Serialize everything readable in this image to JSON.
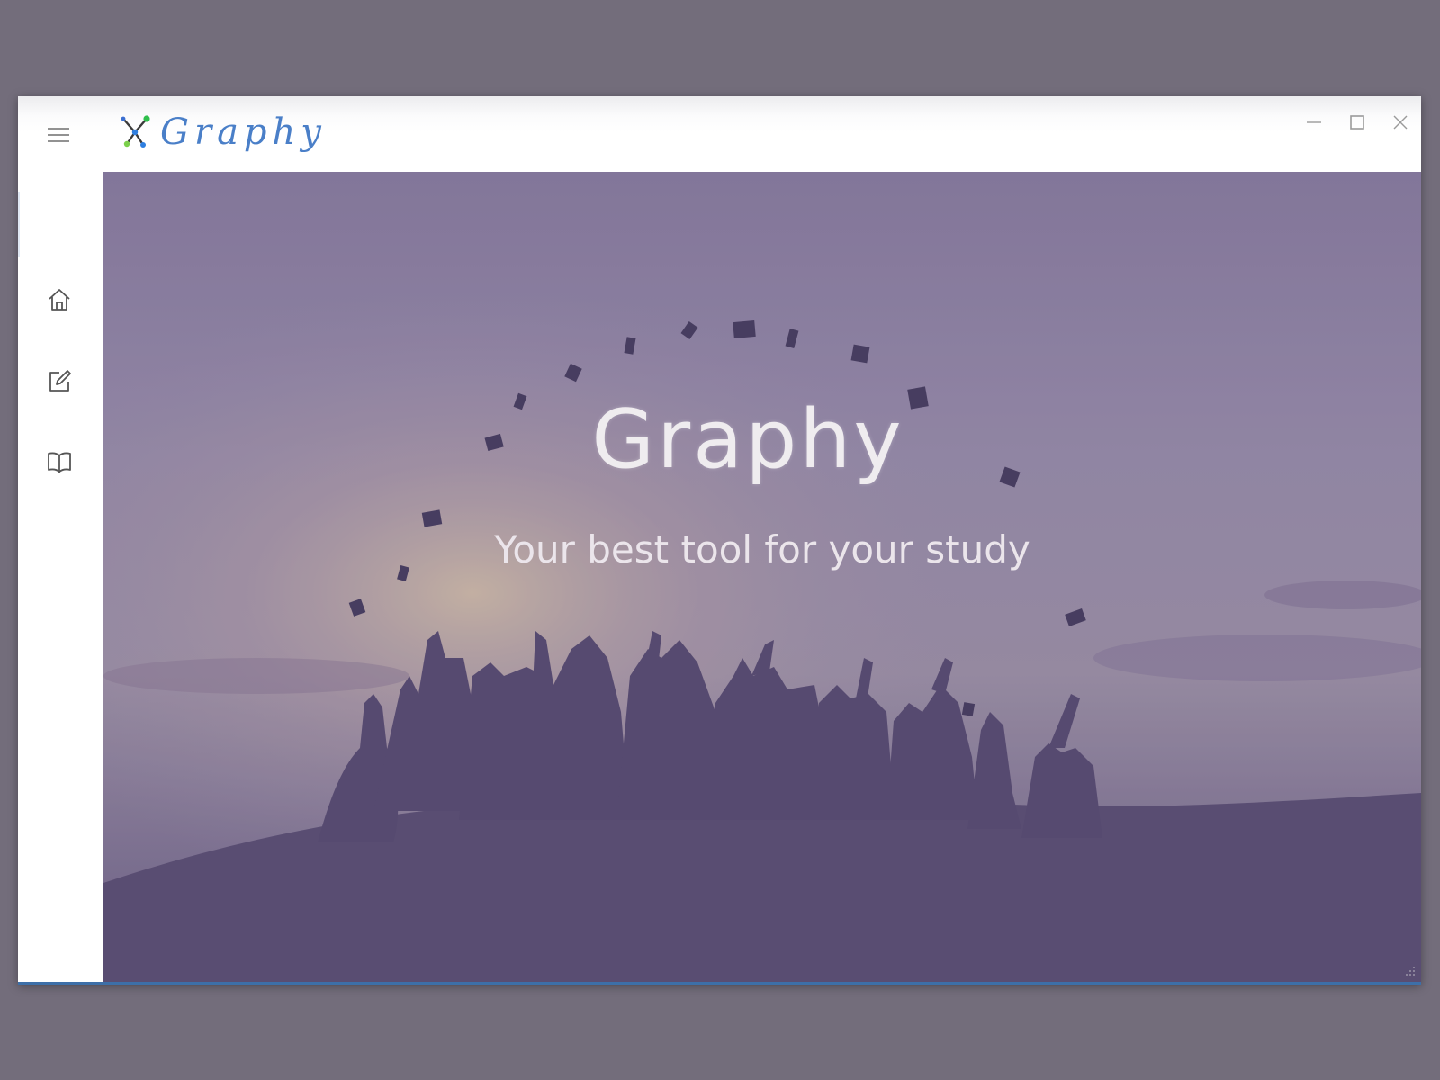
{
  "app": {
    "title": "Graphy"
  },
  "title_bar": {
    "menu_icon": "hamburger-menu-icon",
    "logo_icon": "graph-network-logo",
    "controls": [
      "minimize-icon",
      "maximize-icon",
      "close-icon"
    ]
  },
  "sidebar": {
    "items": [
      {
        "icon": "home-icon",
        "selected": true
      },
      {
        "icon": "edit-icon",
        "selected": false
      },
      {
        "icon": "book-icon",
        "selected": false
      }
    ]
  },
  "hero": {
    "title": "Graphy",
    "subtitle": "Your best tool for your study",
    "image": "graduates-throwing-caps-at-sunset"
  },
  "colors": {
    "logo_text": "#4a7fc8",
    "overlay": "#6f5f8f",
    "accent_line": "#3d6fa8"
  }
}
